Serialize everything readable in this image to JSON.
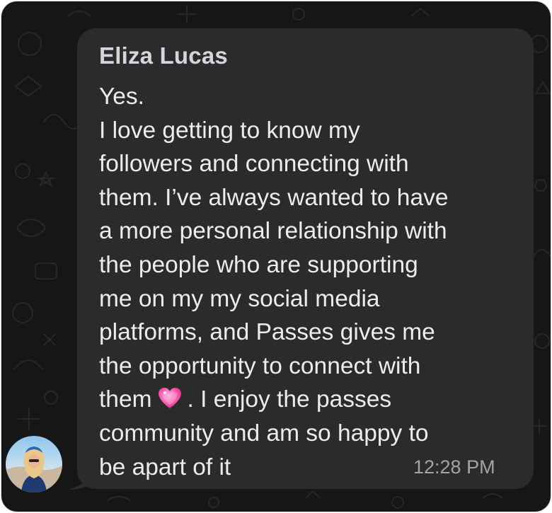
{
  "chat": {
    "sender_name": "Eliza Lucas",
    "message_lines": [
      "Yes.",
      "I love getting to know my",
      "followers and connecting with",
      "them. I’ve always wanted to have",
      "a more personal relationship with",
      "the people who are supporting",
      "me on my my social media",
      "platforms, and Passes gives me",
      "the opportunity to connect with"
    ],
    "line_with_emoji": {
      "before": "them",
      "emoji": "sparkling-heart",
      "after": ". I enjoy the passes"
    },
    "message_lines_end": [
      "community and am so happy to",
      "be apart of it"
    ],
    "timestamp": "12:28 PM"
  },
  "colors": {
    "background": "#161616",
    "bubble": "#2b2b2c",
    "sender_text": "#d6d4dd",
    "message_text": "#ececec",
    "timestamp_text": "#a3a3a8",
    "emoji_heart": "#ff4fae"
  },
  "icons": {
    "avatar": "user-avatar-photo",
    "emoji": "sparkling-heart-emoji"
  }
}
